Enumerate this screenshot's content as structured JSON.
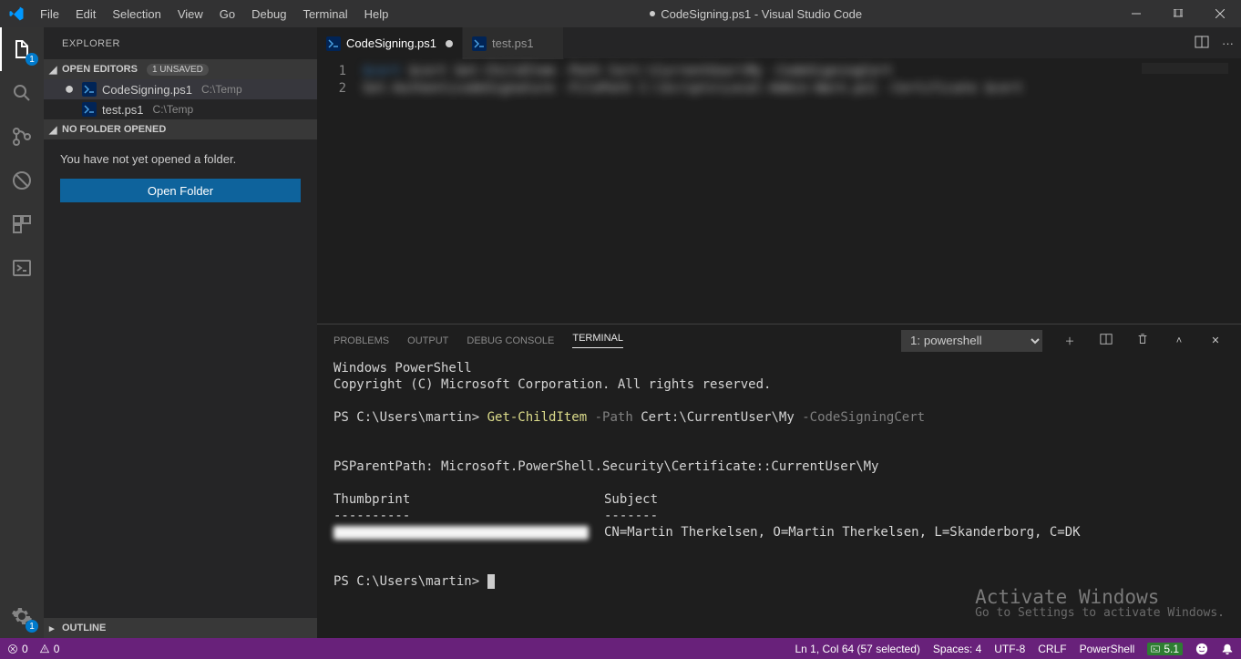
{
  "titlebar": {
    "menus": [
      "File",
      "Edit",
      "Selection",
      "View",
      "Go",
      "Debug",
      "Terminal",
      "Help"
    ],
    "title": "CodeSigning.ps1 - Visual Studio Code"
  },
  "activitybar": {
    "badge_files": "1",
    "badge_settings": "1"
  },
  "sidebar": {
    "header": "Explorer",
    "open_editors_label": "Open Editors",
    "unsaved_badge": "1 UNSAVED",
    "editors": [
      {
        "name": "CodeSigning.ps1",
        "path": "C:\\Temp",
        "dirty": true,
        "active": true
      },
      {
        "name": "test.ps1",
        "path": "C:\\Temp",
        "dirty": false,
        "active": false
      }
    ],
    "no_folder_label": "No Folder Opened",
    "no_folder_msg": "You have not yet opened a folder.",
    "open_folder_btn": "Open Folder",
    "outline_label": "Outline"
  },
  "tabs": [
    {
      "name": "CodeSigning.ps1",
      "active": true,
      "dirty": true
    },
    {
      "name": "test.ps1",
      "active": false,
      "dirty": false
    }
  ],
  "editor": {
    "lines": [
      "1",
      "2"
    ],
    "code_line1": "$cert Get-ChildItem -Path Cert:\\CurrentUser\\My -CodeSigningCert",
    "code_line2": "Set-AuthenticodeSignature -FilePath C:\\Scripts\\Local-Admin-Warn.ps1 -Certificate $cert"
  },
  "panel": {
    "tabs": {
      "problems": "Problems",
      "output": "Output",
      "debug": "Debug Console",
      "terminal": "Terminal"
    },
    "dropdown": "1: powershell",
    "content": {
      "l1": "Windows PowerShell",
      "l2": "Copyright (C) Microsoft Corporation. All rights reserved.",
      "prompt1": "PS C:\\Users\\martin>",
      "cmd": "Get-ChildItem",
      "arg1": "-Path",
      "arg2": "Cert:\\CurrentUser\\My",
      "arg3": "-CodeSigningCert",
      "parent": "    PSParentPath: Microsoft.PowerShell.Security\\Certificate::CurrentUser\\My",
      "col1": "Thumbprint",
      "col2": "Subject",
      "dash1": "----------",
      "dash2": "-------",
      "subject": "CN=Martin Therkelsen, O=Martin Therkelsen, L=Skanderborg, C=DK",
      "prompt2": "PS C:\\Users\\martin>"
    }
  },
  "watermark": {
    "title": "Activate Windows",
    "sub": "Go to Settings to activate Windows."
  },
  "statusbar": {
    "errors": "0",
    "warnings": "0",
    "cursor": "Ln 1, Col 64 (57 selected)",
    "spaces": "Spaces: 4",
    "encoding": "UTF-8",
    "eol": "CRLF",
    "lang": "PowerShell",
    "ext": "5.1"
  }
}
